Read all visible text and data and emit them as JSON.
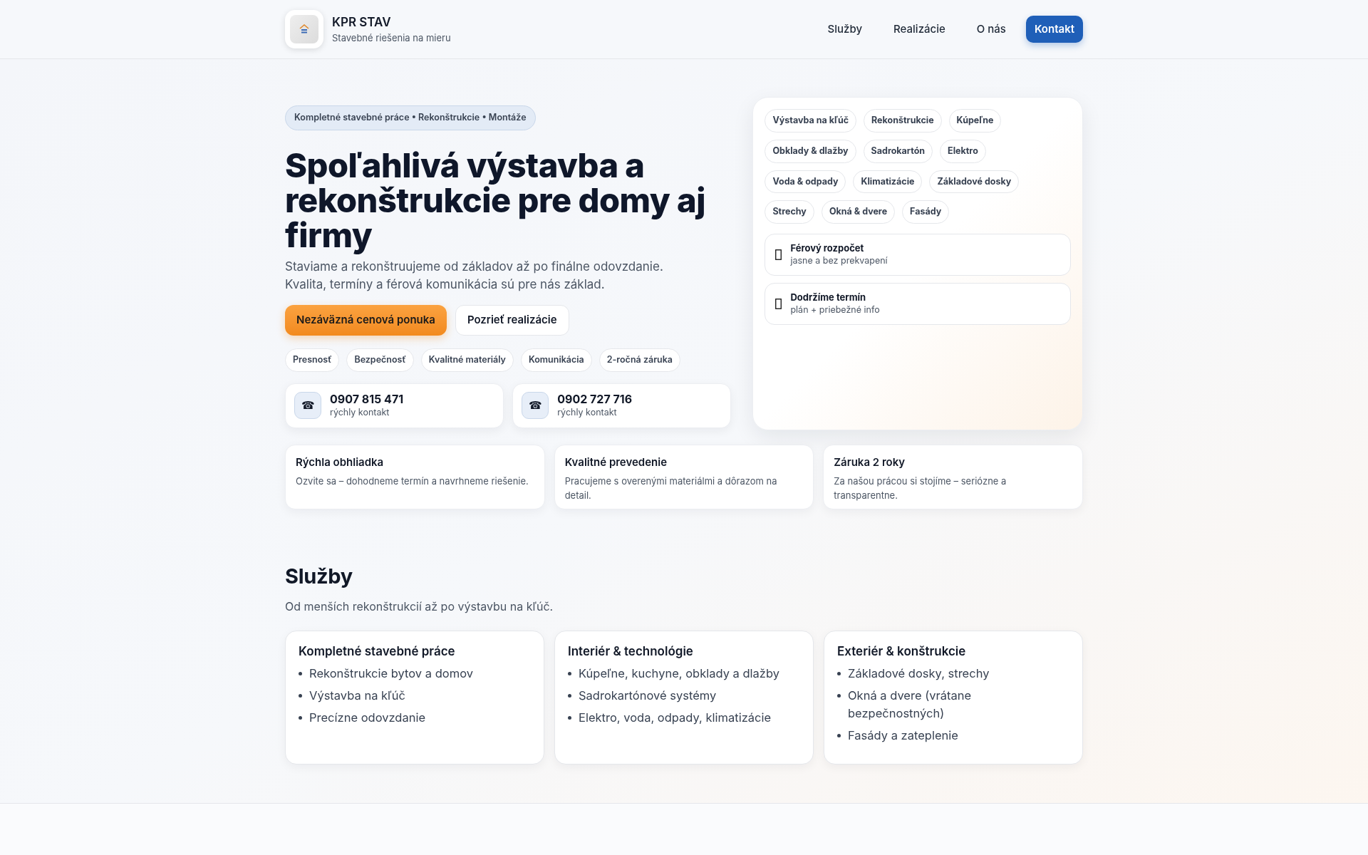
{
  "header": {
    "brand": "KPR STAV",
    "tagline": "Stavebné riešenia na mieru",
    "nav": [
      {
        "label": "Služby",
        "kind": "link"
      },
      {
        "label": "Realizácie",
        "kind": "link"
      },
      {
        "label": "O nás",
        "kind": "link"
      },
      {
        "label": "Kontakt",
        "kind": "cta"
      }
    ]
  },
  "hero": {
    "badge": "Kompletné stavebné práce • Rekonštrukcie • Montáže",
    "title": "Spoľahlivá výstavba a rekonštrukcie pre domy aj firmy",
    "lead": [
      "Staviame a rekonštruujeme od základov až po finálne odovzdanie.",
      "Kvalita, termíny a férová komunikácia sú pre nás základ."
    ],
    "buttons": [
      {
        "label": "Nezáväzná cenová ponuka",
        "kind": "primary"
      },
      {
        "label": "Pozrieť realizácie",
        "kind": "secondary"
      }
    ],
    "values": [
      "Presnosť",
      "Bezpečnosť",
      "Kvalitné materiály",
      "Komunikácia",
      "2-ročná záruka"
    ],
    "phones": [
      {
        "icon": "☎",
        "number": "0907 815 471",
        "note": "rýchly kontakt"
      },
      {
        "icon": "☎",
        "number": "0902 727 716",
        "note": "rýchly kontakt"
      }
    ],
    "tags": [
      "Výstavba na kľúč",
      "Rekonštrukcie",
      "Kúpeľne",
      "Obklady & dlažby",
      "Sadrokartón",
      "Elektro",
      "Voda & odpady",
      "Klimatizácie",
      "Základové dosky",
      "Strechy",
      "Okná & dvere",
      "Fasády"
    ],
    "promises": [
      {
        "title": "Férový rozpočet",
        "note": "jasne a bez prekvapení"
      },
      {
        "title": "Dodržíme termín",
        "note": "plán + priebežné info"
      }
    ]
  },
  "features": [
    {
      "title": "Rýchla obhliadka",
      "text": "Ozvite sa – dohodneme termín a navrhneme riešenie."
    },
    {
      "title": "Kvalitné prevedenie",
      "text": "Pracujeme s overenými materiálmi a dôrazom na detail."
    },
    {
      "title": "Záruka 2 roky",
      "text": "Za našou prácou si stojíme – seriózne a transparentne."
    }
  ],
  "services": {
    "title": "Služby",
    "subtitle": "Od menších rekonštrukcií až po výstavbu na kľúč.",
    "cards": [
      {
        "title": "Kompletné stavebné práce",
        "items": [
          "Rekonštrukcie bytov a domov",
          "Výstavba na kľúč",
          "Precízne odovzdanie"
        ]
      },
      {
        "title": "Interiér & technológie",
        "items": [
          "Kúpeľne, kuchyne, obklady a dlažby",
          "Sadrokartónové systémy",
          "Elektro, voda, odpady, klimatizácie"
        ]
      },
      {
        "title": "Exteriér & konštrukcie",
        "items": [
          "Základové dosky, strechy",
          "Okná a dvere (vrátane bezpečnostných)",
          "Fasády a zateplenie"
        ]
      }
    ]
  }
}
